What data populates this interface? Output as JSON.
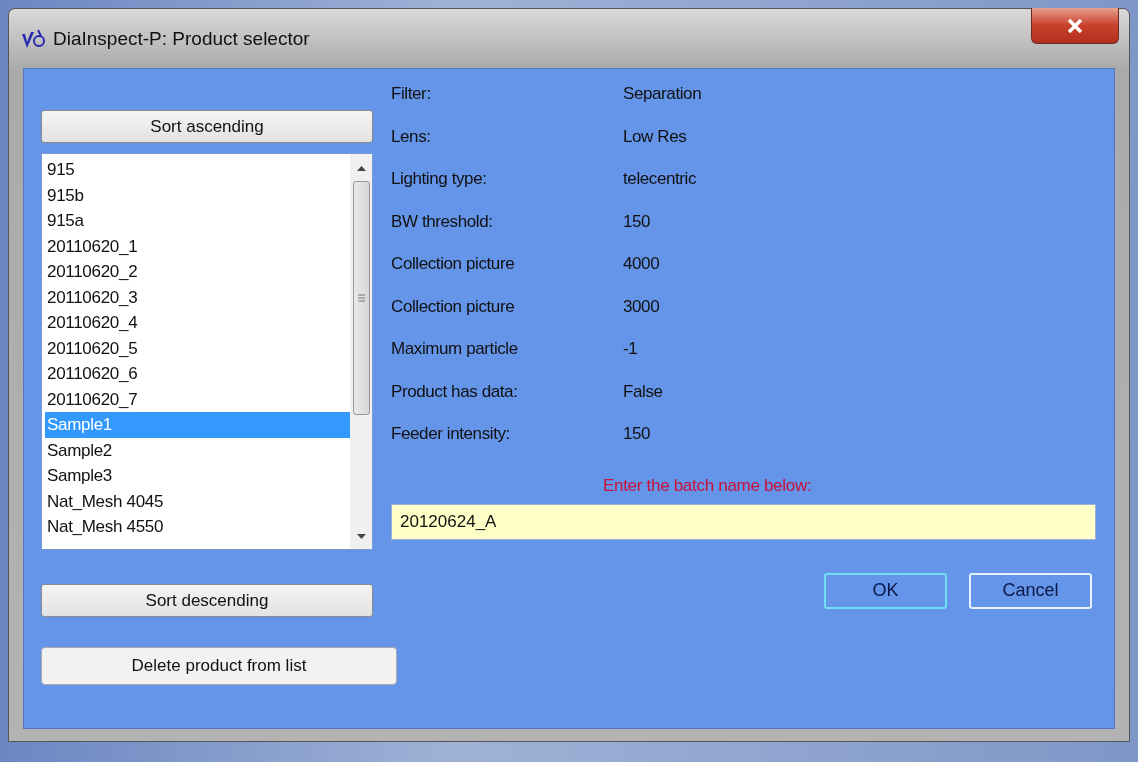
{
  "window": {
    "title": "DiaInspect-P: Product selector"
  },
  "buttons": {
    "sort_ascending": "Sort ascending",
    "sort_descending": "Sort descending",
    "delete": "Delete product from list",
    "ok": "OK",
    "cancel": "Cancel"
  },
  "products": [
    {
      "name": "915",
      "selected": false
    },
    {
      "name": "915b",
      "selected": false
    },
    {
      "name": "915a",
      "selected": false
    },
    {
      "name": "20110620_1",
      "selected": false
    },
    {
      "name": "20110620_2",
      "selected": false
    },
    {
      "name": "20110620_3",
      "selected": false
    },
    {
      "name": "20110620_4",
      "selected": false
    },
    {
      "name": "20110620_5",
      "selected": false
    },
    {
      "name": "20110620_6",
      "selected": false
    },
    {
      "name": "20110620_7",
      "selected": false
    },
    {
      "name": "Sample1",
      "selected": true
    },
    {
      "name": "Sample2",
      "selected": false
    },
    {
      "name": "Sample3",
      "selected": false
    },
    {
      "name": "Nat_Mesh 4045",
      "selected": false
    },
    {
      "name": "Nat_Mesh 4550",
      "selected": false
    }
  ],
  "properties": [
    {
      "label": "Filter:",
      "value": "Separation"
    },
    {
      "label": "Lens:",
      "value": "Low Res"
    },
    {
      "label": "Lighting type:",
      "value": "telecentric"
    },
    {
      "label": "BW threshold:",
      "value": "150"
    },
    {
      "label": "Collection picture",
      "value": "4000"
    },
    {
      "label": "Collection picture",
      "value": "3000"
    },
    {
      "label": "Maximum particle",
      "value": "-1"
    },
    {
      "label": "Product has data:",
      "value": "False"
    },
    {
      "label": "Feeder intensity:",
      "value": "150"
    }
  ],
  "batch_prompt": "Enter the batch name below:",
  "batch_name": {
    "value": "20120624_A"
  }
}
